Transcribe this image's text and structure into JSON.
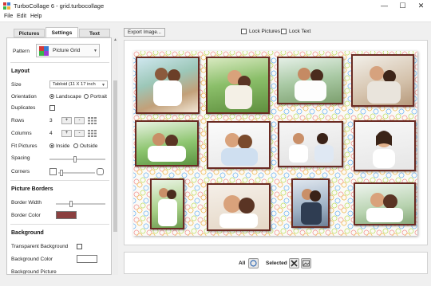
{
  "window": {
    "title": "TurboCollage 6 - grid.turbocollage",
    "minimize_glyph": "—",
    "maximize_glyph": "☐",
    "close_glyph": "✕"
  },
  "menu": [
    "File",
    "Edit",
    "Help"
  ],
  "tabs": [
    {
      "label": "Pictures",
      "active": false
    },
    {
      "label": "Settings",
      "active": true
    },
    {
      "label": "Text",
      "active": false
    }
  ],
  "settings": {
    "pattern_label": "Pattern",
    "pattern_value": "Picture Grid",
    "layout_header": "Layout",
    "size_label": "Size",
    "size_value": "Tabloid (11 X 17 inch",
    "orientation_label": "Orientation",
    "orientation_options": [
      "Landscape",
      "Portrait"
    ],
    "orientation_selected": "Landscape",
    "duplicates_label": "Duplicates",
    "duplicates_checked": false,
    "rows_label": "Rows",
    "rows_value": "3",
    "columns_label": "Columns",
    "columns_value": "4",
    "plus": "+",
    "minus": "-",
    "fit_label": "Fit Pictures",
    "fit_options": [
      "Inside",
      "Outside"
    ],
    "fit_selected": "Inside",
    "spacing_label": "Spacing",
    "spacing_level": 0.45,
    "corners_label": "Corners",
    "corners_level": 0.05,
    "borders_header": "Picture Borders",
    "border_width_label": "Border Width",
    "border_width_level": 0.3,
    "border_color_label": "Border Color",
    "border_color": "#8b4040",
    "background_header": "Background",
    "transparent_bg_label": "Transparent Background",
    "transparent_bg_checked": false,
    "bg_color_label": "Background Color",
    "bg_picture_label": "Background Picture"
  },
  "toolbar": {
    "export_button": "Export Image...",
    "lock_pictures": "Lock Pictures",
    "lock_text": "Lock Text"
  },
  "bottom": {
    "all_label": "All",
    "selected_label": "Selected"
  },
  "collage": {
    "icons": [
      "photo-couple-beach",
      "photo-couple-park",
      "photo-couple-lake",
      "photo-couple-sofa",
      "photo-couple-grass",
      "photo-couple-embrace",
      "photo-couple-coffee",
      "photo-woman-smiling",
      "photo-couple-standing",
      "photo-couple-closeup",
      "photo-couple-city",
      "photo-couple-laughing"
    ],
    "colors": {
      "frame": "#6a2a22",
      "dots": [
        "#f1c36c",
        "#8ac2f5",
        "#c9e37d",
        "#f3a6a6"
      ]
    }
  }
}
